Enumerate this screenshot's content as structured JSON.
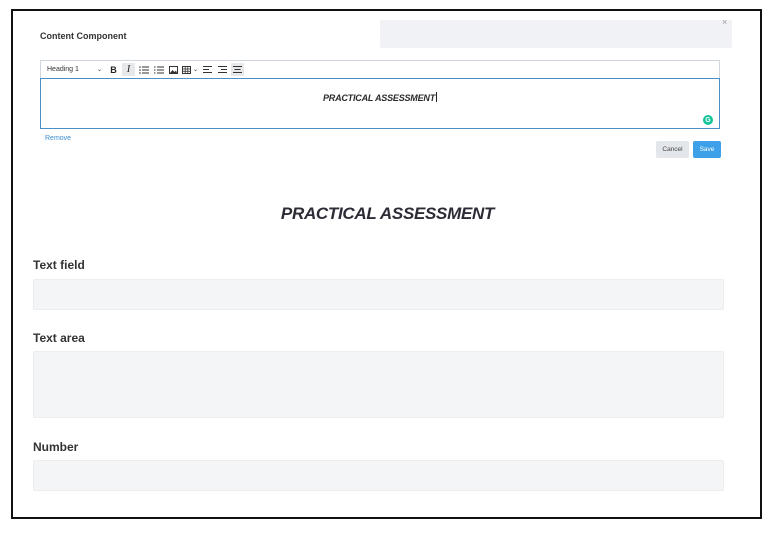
{
  "modal": {
    "title": "Content Component",
    "close_symbol": "×"
  },
  "toolbar": {
    "heading_select": "Heading 1",
    "caret_symbol": "⌄",
    "icons": [
      "bold-icon",
      "italic-icon",
      "bullet-list-icon",
      "numbered-list-icon",
      "image-icon",
      "table-icon",
      "align-left-icon",
      "align-right-icon",
      "align-center-icon"
    ],
    "bold_label": "B",
    "italic_label": "I"
  },
  "editor": {
    "content": "PRACTICAL ASSESSMENT",
    "grammarly_badge": "G"
  },
  "actions": {
    "remove_label": "Remove",
    "cancel_label": "Cancel",
    "save_label": "Save"
  },
  "preview": {
    "heading": "PRACTICAL ASSESSMENT",
    "fields": [
      {
        "label": "Text field",
        "value": ""
      },
      {
        "label": "Text area",
        "value": ""
      },
      {
        "label": "Number",
        "value": ""
      }
    ]
  },
  "colors": {
    "accent": "#3ea0e8",
    "editor_border": "#4a90c8",
    "field_bg": "#f4f5f6",
    "grammarly": "#15c39a"
  }
}
